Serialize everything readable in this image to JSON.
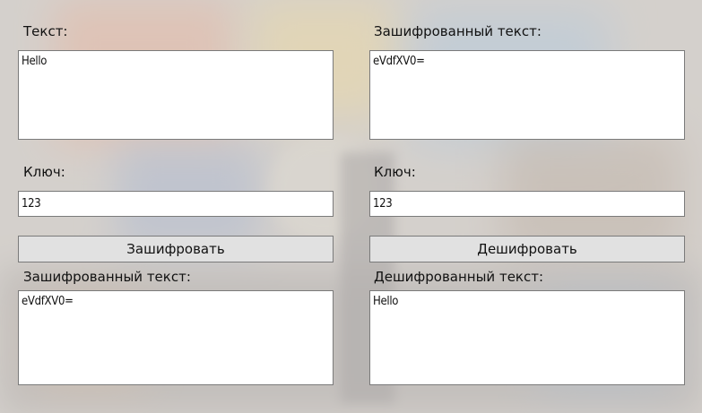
{
  "left": {
    "text_label": "Текст:",
    "text_value": "Hello",
    "key_label": "Ключ:",
    "key_value": "123",
    "button_label": "Зашифровать",
    "result_label": "Зашифрованный текст:",
    "result_value": "eVdfXV0="
  },
  "right": {
    "text_label": "Зашифрованный текст:",
    "text_value": "eVdfXV0=",
    "key_label": "Ключ:",
    "key_value": "123",
    "button_label": "Дешифровать",
    "result_label": "Дешифрованный текст:",
    "result_value": "Hello"
  },
  "colors": {
    "input_background": "#ffffff",
    "button_background": "#e1e1e1",
    "border": "#7a7a7a"
  }
}
